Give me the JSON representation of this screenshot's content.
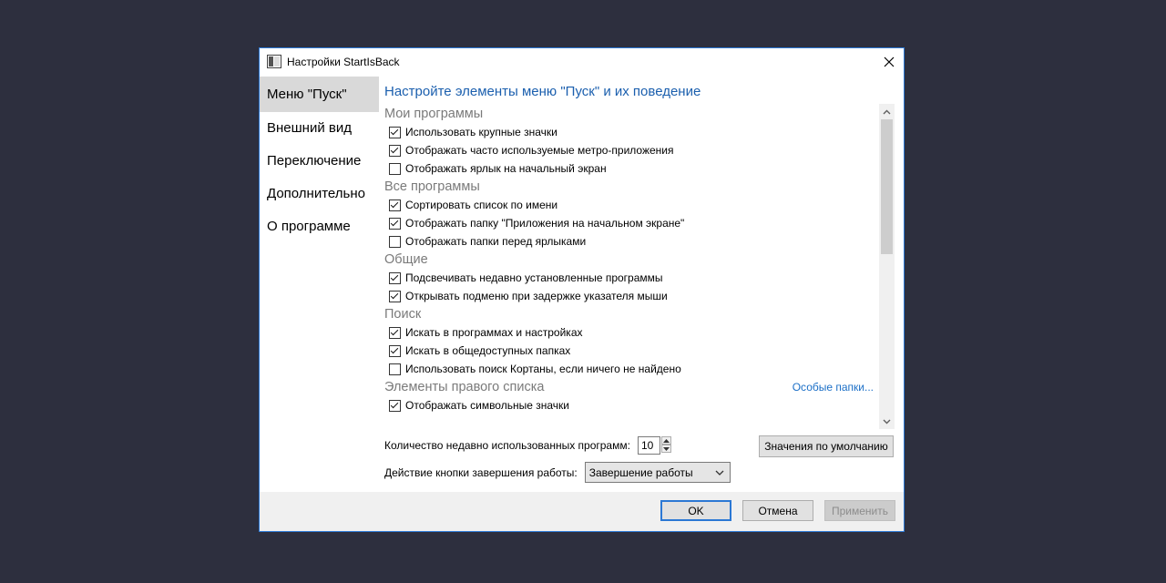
{
  "window": {
    "title": "Настройки StartIsBack",
    "heading": "Настройте элементы меню \"Пуск\" и их поведение"
  },
  "sidebar": {
    "items": [
      {
        "label": "Меню \"Пуск\"",
        "active": true
      },
      {
        "label": "Внешний вид"
      },
      {
        "label": "Переключение"
      },
      {
        "label": "Дополнительно"
      },
      {
        "label": "О программе"
      }
    ]
  },
  "groups": [
    {
      "title": "Мои программы",
      "options": [
        {
          "label": "Использовать крупные значки",
          "checked": true
        },
        {
          "label": "Отображать часто используемые метро-приложения",
          "checked": true
        },
        {
          "label": "Отображать ярлык на начальный экран",
          "checked": false
        }
      ]
    },
    {
      "title": "Все программы",
      "options": [
        {
          "label": "Сортировать список по имени",
          "checked": true
        },
        {
          "label": "Отображать папку \"Приложения на начальном экране\"",
          "checked": true
        },
        {
          "label": "Отображать папки перед ярлыками",
          "checked": false
        }
      ]
    },
    {
      "title": "Общие",
      "options": [
        {
          "label": "Подсвечивать недавно установленные программы",
          "checked": true
        },
        {
          "label": "Открывать подменю при задержке указателя мыши",
          "checked": true
        }
      ]
    },
    {
      "title": "Поиск",
      "options": [
        {
          "label": "Искать в программах и настройках",
          "checked": true
        },
        {
          "label": "Искать в общедоступных папках",
          "checked": true
        },
        {
          "label": "Использовать поиск Кортаны, если ничего не найдено",
          "checked": false
        }
      ]
    },
    {
      "title": "Элементы правого списка",
      "link": "Особые папки...",
      "options": [
        {
          "label": "Отображать символьные значки",
          "checked": true
        }
      ]
    }
  ],
  "recent": {
    "label": "Количество недавно использованных программ:",
    "value": "10"
  },
  "defaults_button": "Значения по умолчанию",
  "shutdown": {
    "label": "Действие кнопки завершения работы:",
    "value": "Завершение работы"
  },
  "footer": {
    "ok": "OK",
    "cancel": "Отмена",
    "apply": "Применить"
  }
}
